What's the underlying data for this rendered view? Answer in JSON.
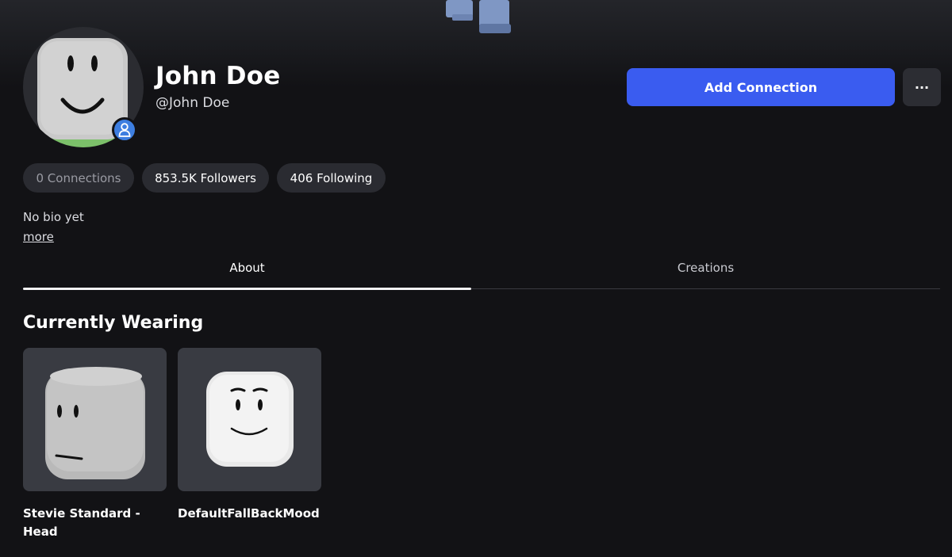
{
  "profile": {
    "display_name": "John Doe",
    "username": "@John Doe",
    "bio": "No bio yet",
    "bio_more": "more"
  },
  "actions": {
    "add_connection_label": "Add Connection",
    "more_label": "···"
  },
  "stats": {
    "connections": "0 Connections",
    "followers": "853.5K Followers",
    "following": "406 Following"
  },
  "tabs": [
    {
      "label": "About",
      "active": true
    },
    {
      "label": "Creations",
      "active": false
    }
  ],
  "wearing": {
    "title": "Currently Wearing",
    "items": [
      {
        "name": "Stevie Standard - Head"
      },
      {
        "name": "DefaultFallBackMood"
      }
    ]
  },
  "icons": {
    "presence": "person-icon",
    "more": "ellipsis-icon"
  },
  "colors": {
    "accent": "#3a5cf0",
    "background": "#121215",
    "presence": "#3d7ee0"
  }
}
